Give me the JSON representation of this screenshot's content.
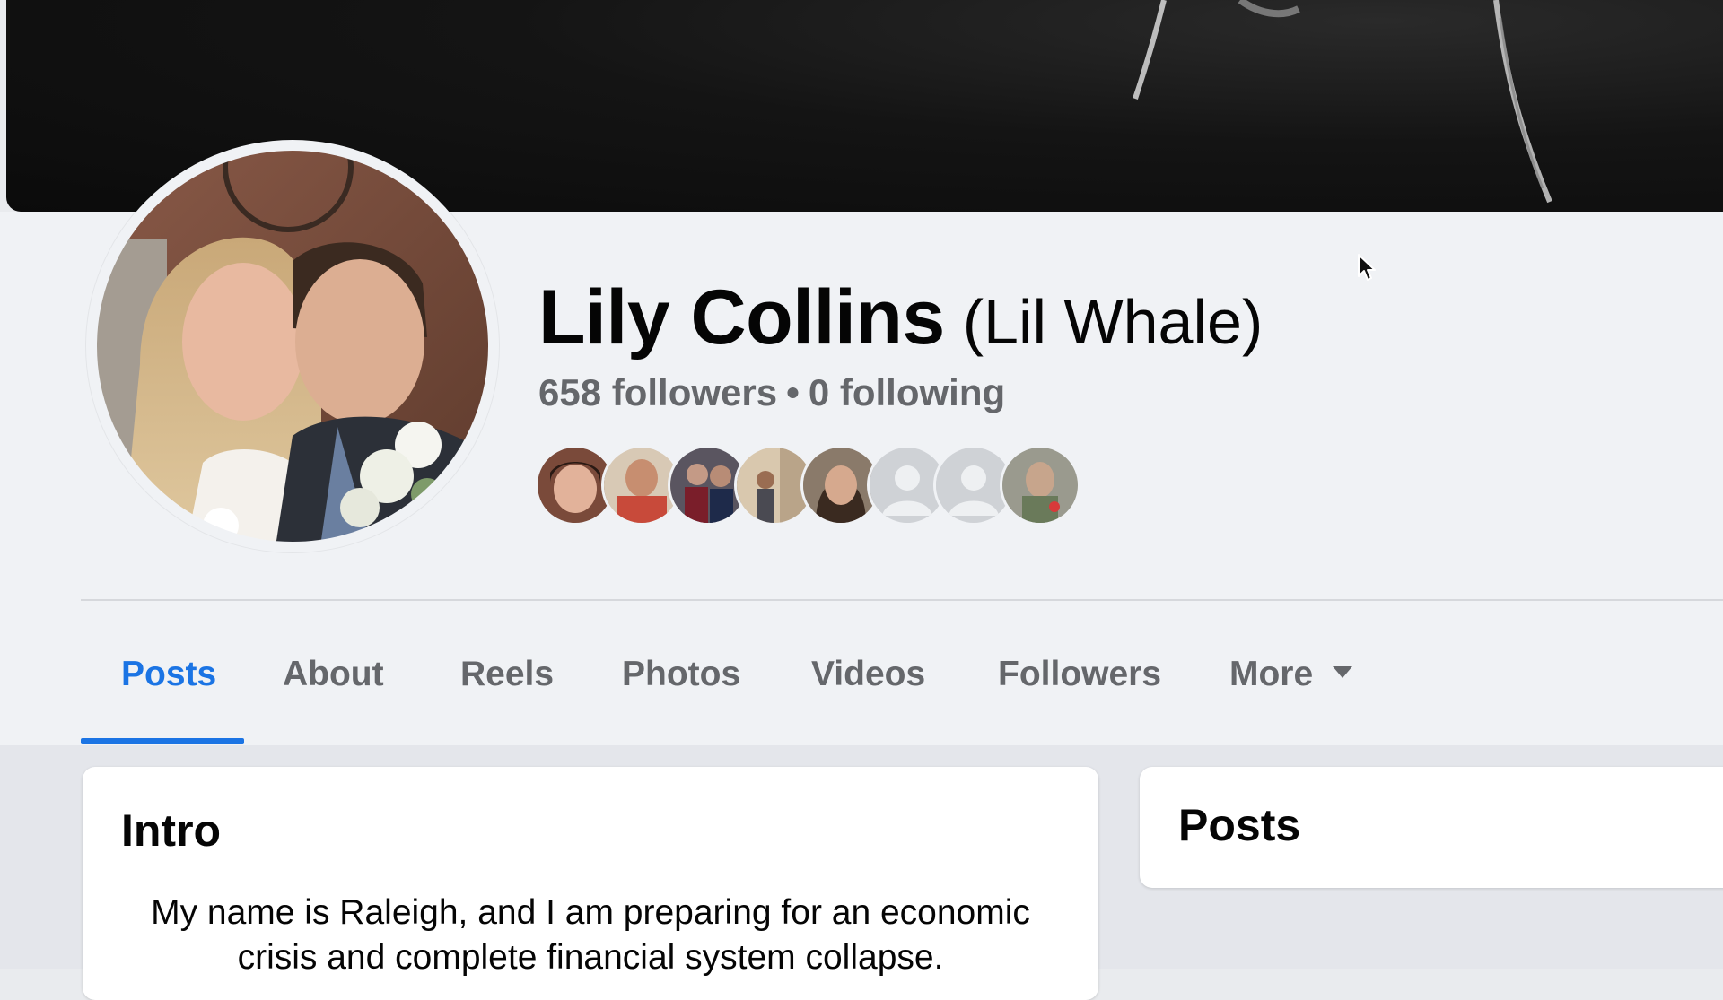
{
  "profile": {
    "name": "Lily Collins",
    "alternate_name": "(Lil Whale)",
    "followers": "658 followers",
    "separator": "•",
    "following": "0 following"
  },
  "friends": [
    {
      "icon": "friend-avatar",
      "color": "#7a4a3a"
    },
    {
      "icon": "friend-avatar",
      "color": "#b8654d"
    },
    {
      "icon": "friend-avatar",
      "color": "#3d3a4a"
    },
    {
      "icon": "friend-avatar",
      "color": "#c9b49a"
    },
    {
      "icon": "friend-avatar",
      "color": "#6b5a4a"
    },
    {
      "icon": "default-avatar",
      "color": "#cfd2d6"
    },
    {
      "icon": "default-avatar",
      "color": "#cfd2d6"
    },
    {
      "icon": "friend-avatar",
      "color": "#8a8a7a"
    }
  ],
  "tabs": {
    "posts": "Posts",
    "about": "About",
    "reels": "Reels",
    "photos": "Photos",
    "videos": "Videos",
    "followers": "Followers",
    "more": "More"
  },
  "intro": {
    "title": "Intro",
    "bio": "My name is Raleigh, and I am preparing for an economic crisis and complete financial system collapse."
  },
  "posts_card": {
    "title": "Posts"
  },
  "colors": {
    "accent": "#1b74e4",
    "secondary_text": "#65676b",
    "primary_text": "#050505",
    "header_bg": "#f0f2f5"
  }
}
